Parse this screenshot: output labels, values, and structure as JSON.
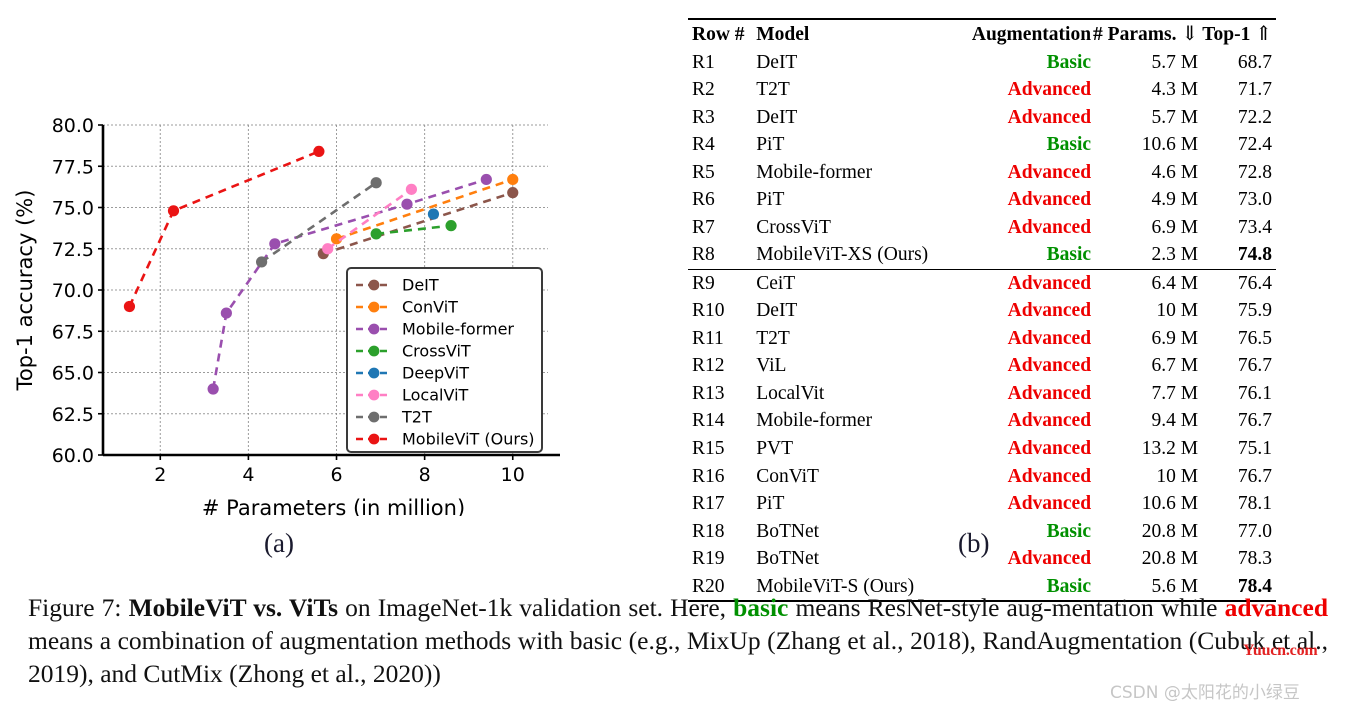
{
  "figure": {
    "subfig_a_label": "(a)",
    "subfig_b_label": "(b)"
  },
  "caption": {
    "prefix": "Figure 7: ",
    "bold_title": "MobileViT vs. ViTs",
    "seg1": " on ImageNet-1k validation set. Here, ",
    "basic_word": "basic",
    "seg2": " means ResNet-style aug-mentation while ",
    "advanced_word": "advanced",
    "seg3": " means a combination of augmentation methods with basic (e.g., MixUp (Zhang et al., 2018), RandAugmentation (Cubuk et al., 2019), and CutMix (Zhong et al., 2020))"
  },
  "watermarks": {
    "red": "Yuucn.com",
    "gray": "CSDN @太阳花的小绿豆"
  },
  "table": {
    "headers": {
      "row": "Row #",
      "model": "Model",
      "augmentation": "Augmentation",
      "params": "# Params.",
      "params_arrow": "⇓",
      "top1": "Top-1",
      "top1_arrow": "⇑"
    },
    "group1": [
      {
        "row": "R1",
        "model": "DeIT",
        "aug": "Basic",
        "aug_kind": "basic",
        "params": "5.7 M",
        "top1": "68.7",
        "top1_bold": false
      },
      {
        "row": "R2",
        "model": "T2T",
        "aug": "Advanced",
        "aug_kind": "advanced",
        "params": "4.3 M",
        "top1": "71.7",
        "top1_bold": false
      },
      {
        "row": "R3",
        "model": "DeIT",
        "aug": "Advanced",
        "aug_kind": "advanced",
        "params": "5.7 M",
        "top1": "72.2",
        "top1_bold": false
      },
      {
        "row": "R4",
        "model": "PiT",
        "aug": "Basic",
        "aug_kind": "basic",
        "params": "10.6 M",
        "top1": "72.4",
        "top1_bold": false
      },
      {
        "row": "R5",
        "model": "Mobile-former",
        "aug": "Advanced",
        "aug_kind": "advanced",
        "params": "4.6 M",
        "top1": "72.8",
        "top1_bold": false
      },
      {
        "row": "R6",
        "model": "PiT",
        "aug": "Advanced",
        "aug_kind": "advanced",
        "params": "4.9 M",
        "top1": "73.0",
        "top1_bold": false
      },
      {
        "row": "R7",
        "model": "CrossViT",
        "aug": "Advanced",
        "aug_kind": "advanced",
        "params": "6.9 M",
        "top1": "73.4",
        "top1_bold": false
      },
      {
        "row": "R8",
        "model": "MobileViT-XS (Ours)",
        "aug": "Basic",
        "aug_kind": "basic",
        "params": "2.3 M",
        "top1": "74.8",
        "top1_bold": true
      }
    ],
    "group2": [
      {
        "row": "R9",
        "model": "CeiT",
        "aug": "Advanced",
        "aug_kind": "advanced",
        "params": "6.4 M",
        "top1": "76.4",
        "top1_bold": false
      },
      {
        "row": "R10",
        "model": "DeIT",
        "aug": "Advanced",
        "aug_kind": "advanced",
        "params": "10 M",
        "top1": "75.9",
        "top1_bold": false
      },
      {
        "row": "R11",
        "model": "T2T",
        "aug": "Advanced",
        "aug_kind": "advanced",
        "params": "6.9 M",
        "top1": "76.5",
        "top1_bold": false
      },
      {
        "row": "R12",
        "model": "ViL",
        "aug": "Advanced",
        "aug_kind": "advanced",
        "params": "6.7 M",
        "top1": "76.7",
        "top1_bold": false
      },
      {
        "row": "R13",
        "model": "LocalVit",
        "aug": "Advanced",
        "aug_kind": "advanced",
        "params": "7.7 M",
        "top1": "76.1",
        "top1_bold": false
      },
      {
        "row": "R14",
        "model": "Mobile-former",
        "aug": "Advanced",
        "aug_kind": "advanced",
        "params": "9.4 M",
        "top1": "76.7",
        "top1_bold": false
      },
      {
        "row": "R15",
        "model": "PVT",
        "aug": "Advanced",
        "aug_kind": "advanced",
        "params": "13.2 M",
        "top1": "75.1",
        "top1_bold": false
      },
      {
        "row": "R16",
        "model": "ConViT",
        "aug": "Advanced",
        "aug_kind": "advanced",
        "params": "10 M",
        "top1": "76.7",
        "top1_bold": false
      },
      {
        "row": "R17",
        "model": "PiT",
        "aug": "Advanced",
        "aug_kind": "advanced",
        "params": "10.6 M",
        "top1": "78.1",
        "top1_bold": false
      },
      {
        "row": "R18",
        "model": "BoTNet",
        "aug": "Basic",
        "aug_kind": "basic",
        "params": "20.8 M",
        "top1": "77.0",
        "top1_bold": false
      },
      {
        "row": "R19",
        "model": "BoTNet",
        "aug": "Advanced",
        "aug_kind": "advanced",
        "params": "20.8 M",
        "top1": "78.3",
        "top1_bold": false
      },
      {
        "row": "R20",
        "model": "MobileViT-S (Ours)",
        "aug": "Basic",
        "aug_kind": "basic",
        "params": "5.6 M",
        "top1": "78.4",
        "top1_bold": true
      }
    ]
  },
  "chart_data": {
    "type": "line",
    "title": "",
    "xlabel": "# Parameters (in million)",
    "ylabel": "Top-1 accuracy (%)",
    "xlim": [
      0.7,
      10.8
    ],
    "ylim": [
      60.0,
      80.0
    ],
    "xticks": [
      2,
      4,
      6,
      8,
      10
    ],
    "xtick_labels": [
      "2",
      "4",
      "6",
      "8",
      "10"
    ],
    "yticks": [
      60.0,
      62.5,
      65.0,
      67.5,
      70.0,
      72.5,
      75.0,
      77.5,
      80.0
    ],
    "ytick_labels": [
      "60.0",
      "62.5",
      "65.0",
      "67.5",
      "70.0",
      "72.5",
      "75.0",
      "77.5",
      "80.0"
    ],
    "grid": true,
    "linestyle": "dashed",
    "legend_position": "lower right",
    "series": [
      {
        "name": "DeIT",
        "color": "#8c564b",
        "x": [
          5.7,
          10.0
        ],
        "y": [
          72.2,
          75.9
        ]
      },
      {
        "name": "ConViT",
        "color": "#ff7f0e",
        "x": [
          6.0,
          10.0
        ],
        "y": [
          73.1,
          76.7
        ]
      },
      {
        "name": "Mobile-former",
        "color": "#9a4fae",
        "x": [
          3.2,
          3.5,
          4.6,
          7.6,
          9.4
        ],
        "y": [
          64.0,
          68.6,
          72.8,
          75.2,
          76.7
        ]
      },
      {
        "name": "CrossViT",
        "color": "#2ca02c",
        "x": [
          6.9,
          8.6
        ],
        "y": [
          73.4,
          73.9
        ]
      },
      {
        "name": "DeepViT",
        "color": "#1f77b4",
        "x": [
          8.2
        ],
        "y": [
          74.6
        ]
      },
      {
        "name": "LocalViT",
        "color": "#ff7fc4",
        "x": [
          5.8,
          7.7
        ],
        "y": [
          72.5,
          76.1
        ]
      },
      {
        "name": "T2T",
        "color": "#6e6e6e",
        "x": [
          4.3,
          6.9
        ],
        "y": [
          71.7,
          76.5
        ]
      },
      {
        "name": "MobileViT (Ours)",
        "color": "#ea1414",
        "x": [
          1.3,
          2.3,
          5.6
        ],
        "y": [
          69.0,
          74.8,
          78.4
        ]
      }
    ]
  }
}
